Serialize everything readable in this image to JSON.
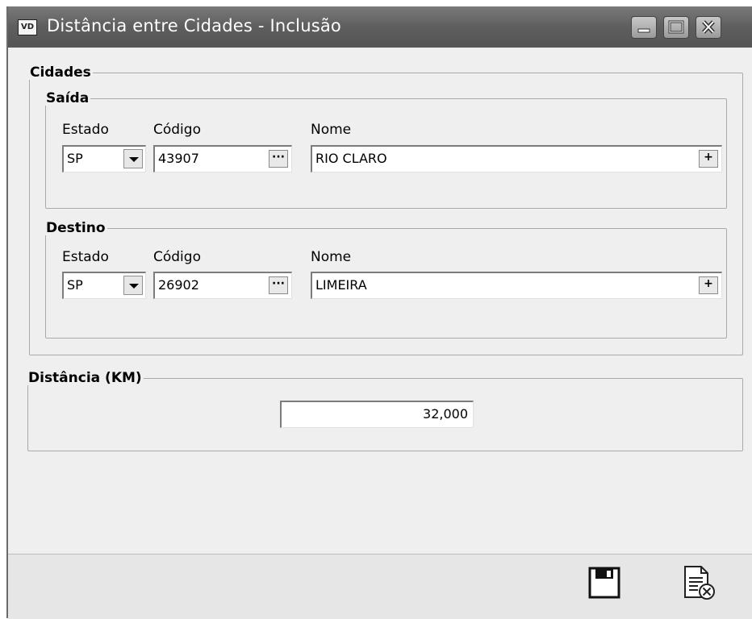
{
  "window": {
    "logo_text": "VD",
    "title": "Distância entre Cidades - Inclusão"
  },
  "cidades": {
    "legend": "Cidades",
    "saida": {
      "legend": "Saída",
      "estado_label": "Estado",
      "codigo_label": "Código",
      "nome_label": "Nome",
      "estado": "SP",
      "codigo": "43907",
      "nome": "RIO CLARO"
    },
    "destino": {
      "legend": "Destino",
      "estado_label": "Estado",
      "codigo_label": "Código",
      "nome_label": "Nome",
      "estado": "SP",
      "codigo": "26902",
      "nome": "LIMEIRA"
    }
  },
  "distancia": {
    "legend": "Distância (KM)",
    "value": "32,000"
  },
  "buttons": {
    "lookup_label": "···",
    "add_label": "+"
  },
  "icons": {
    "save": "floppy-disk-icon",
    "cancel": "document-cancel-icon"
  }
}
